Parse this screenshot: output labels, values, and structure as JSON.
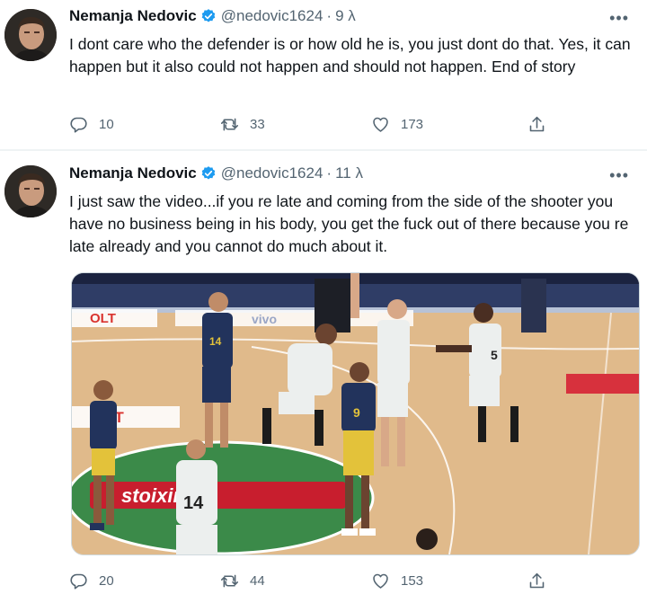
{
  "tweets": [
    {
      "author_name": "Nemanja Nedovic",
      "handle": "@nedovic1624",
      "separator": "·",
      "time": "9 λ",
      "text": "I dont care who the defender is or how old he is, you just dont do that. Yes, it can happen but it also could not happen and should not happen. End of story",
      "more_label": "•••",
      "reply_count": "10",
      "retweet_count": "33",
      "like_count": "173"
    },
    {
      "author_name": "Nemanja Nedovic",
      "handle": "@nedovic1624",
      "separator": "·",
      "time": "11 λ",
      "text": "I just saw the video...if you re late and coming from the side of the shooter you have no business being in his body, you get the fuck out of there because you re late already and you cannot do much about it.",
      "more_label": "•••",
      "reply_count": "20",
      "retweet_count": "44",
      "like_count": "153",
      "media": {
        "court_sign_1": "OLT",
        "court_sign_2": "vivo",
        "court_sign_3": "OLT",
        "center_logo": "stoiximan",
        "jersey_front": "14",
        "jersey_white_right": "5",
        "jersey_blue_center": "9",
        "jersey_blue_left": "14"
      }
    }
  ],
  "colors": {
    "text": "#0f1419",
    "secondary": "#536471",
    "verified_blue": "#1d9bf0",
    "court_floor": "#e1ba8c",
    "center_circle": "#3b8a49",
    "sponsor_red": "#c81e2e"
  }
}
